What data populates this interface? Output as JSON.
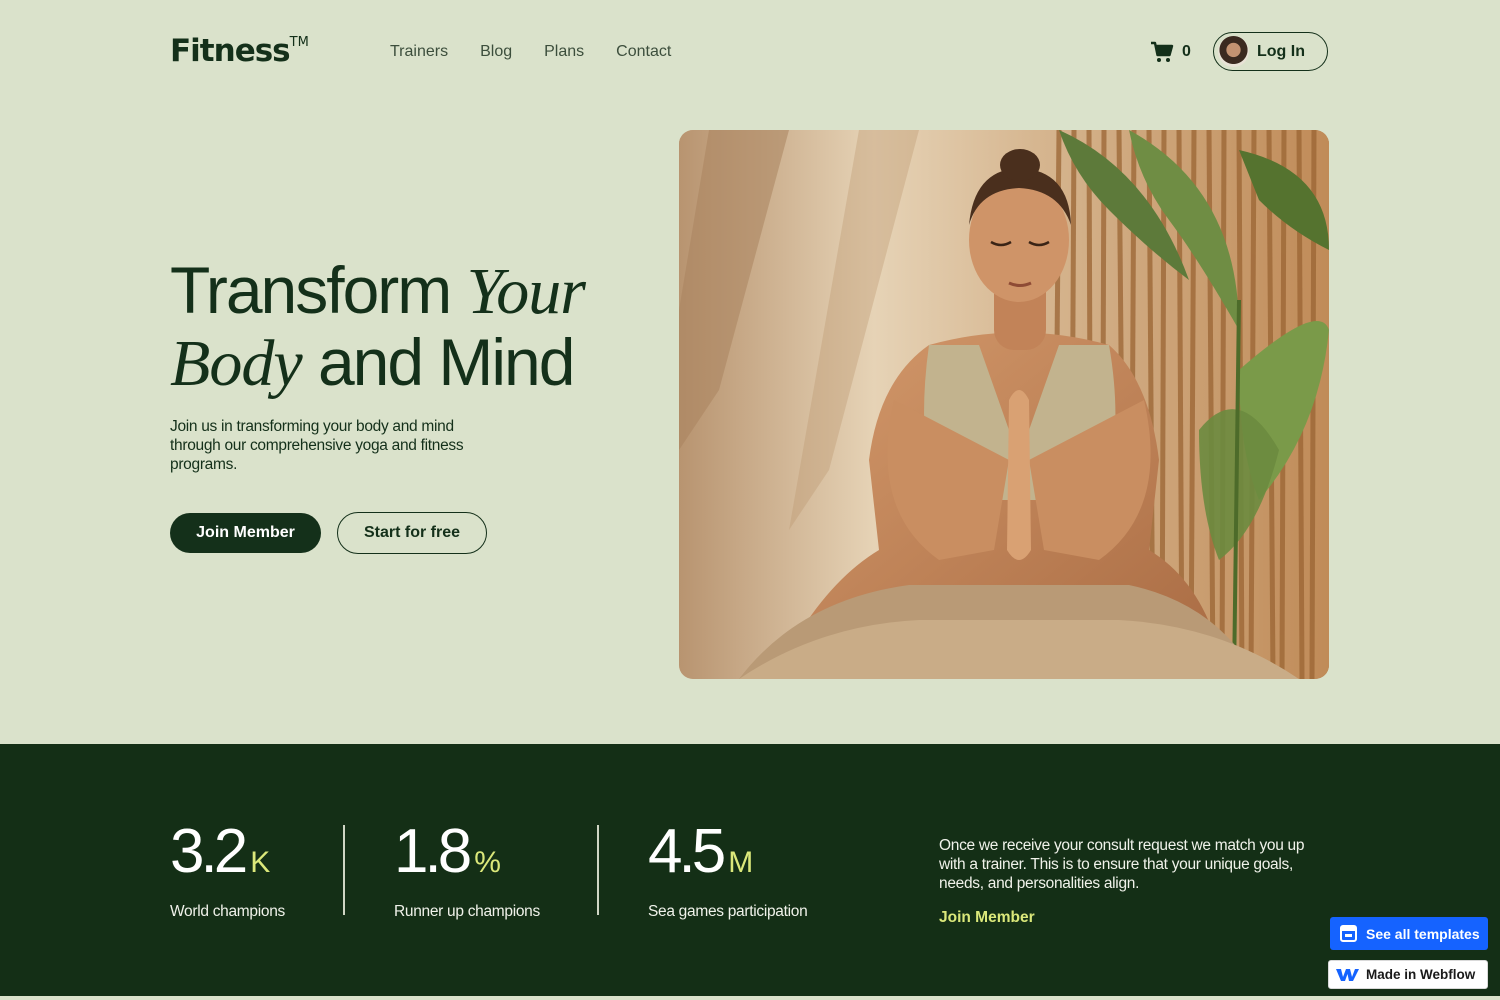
{
  "nav": {
    "logo": "Fitness",
    "logo_mark": "TM",
    "links": [
      "Trainers",
      "Blog",
      "Plans",
      "Contact"
    ],
    "cart_icon": "cart-icon",
    "cart_count": "0",
    "login_label": "Log In"
  },
  "hero": {
    "title_part1": "Transform ",
    "title_italic1": "Your",
    "title_italic2": "Body",
    "title_part2": " and Mind",
    "subtitle": "Join us in transforming your body and mind through our comprehensive yoga and fitness programs.",
    "join_button": "Join Member",
    "free_button": "Start for free"
  },
  "stats": [
    {
      "value": "3.2",
      "unit": "K",
      "label": "World champions"
    },
    {
      "value": "1.8",
      "unit": "%",
      "label": "Runner up champions"
    },
    {
      "value": "4.5",
      "unit": "M",
      "label": "Sea games participation"
    }
  ],
  "band": {
    "text": "Once we receive your consult request we match you up with a trainer. This is to ensure that your unique goals, needs, and personalities align.",
    "link": "Join Member"
  },
  "badges": {
    "templates_label": "See all templates",
    "webflow_label": "Made in Webflow"
  },
  "colors": {
    "background": "#dae2cb",
    "dark_green": "#142f16",
    "accent_lime": "#dbe87a",
    "webflow_blue": "#1563ff"
  }
}
